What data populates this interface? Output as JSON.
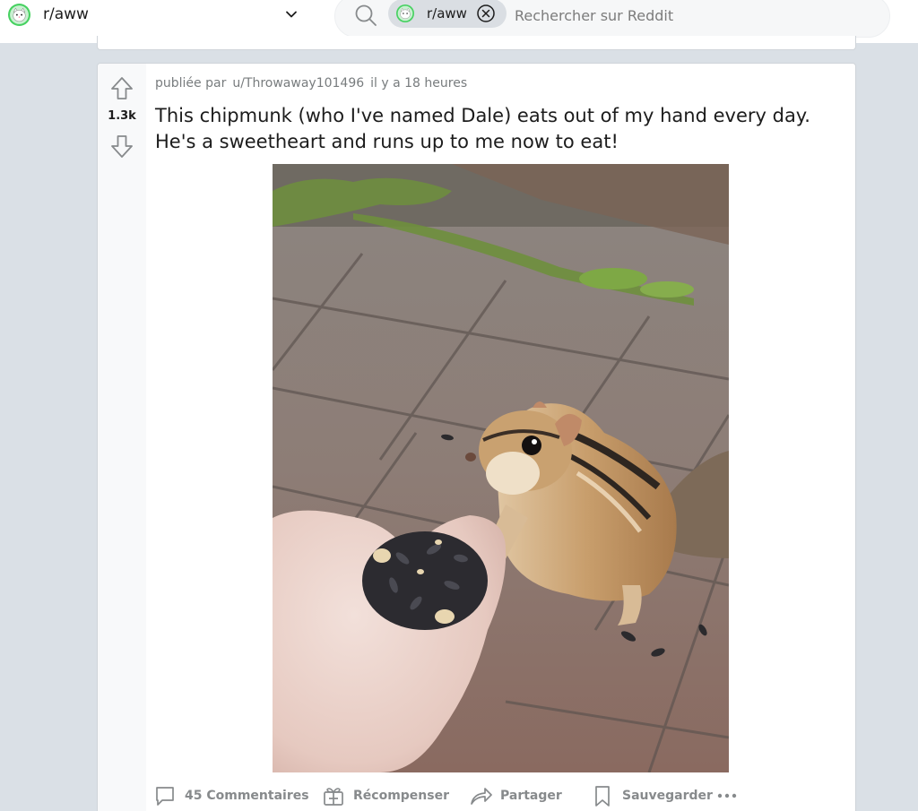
{
  "header": {
    "subreddit": "r/aww",
    "search": {
      "chip_label": "r/aww",
      "placeholder": "Rechercher sur Reddit",
      "value": ""
    }
  },
  "post": {
    "score": "1.3k",
    "meta": {
      "prefix": "publiée par",
      "author": "u/Throwaway101496",
      "time": "il y a 18 heures"
    },
    "title": "This chipmunk (who I've named Dale) eats out of my hand every day. He's a sweetheart and runs up to me now to eat!",
    "actions": {
      "comments": "45 Commentaires",
      "award": "Récompenser",
      "share": "Partager",
      "save": "Sauvegarder"
    }
  },
  "colors": {
    "page_bg": "#dae0e6",
    "card_bg": "#ffffff",
    "vote_col_bg": "#f8f9fa",
    "meta_text": "#787c7e",
    "action_text": "#878a8c"
  },
  "icons": [
    "subreddit-icon",
    "chevron-down-icon",
    "search-icon",
    "close-icon",
    "upvote-icon",
    "downvote-icon",
    "comment-icon",
    "award-icon",
    "share-icon",
    "bookmark-icon",
    "more-icon"
  ]
}
